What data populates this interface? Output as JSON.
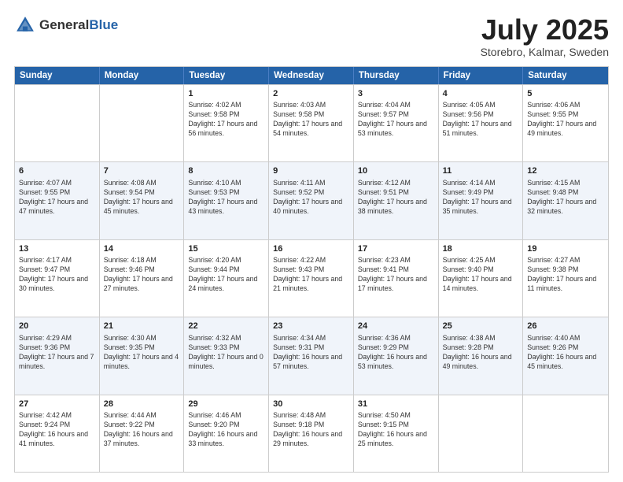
{
  "header": {
    "logo_general": "General",
    "logo_blue": "Blue",
    "month_title": "July 2025",
    "location": "Storebro, Kalmar, Sweden"
  },
  "weekdays": [
    "Sunday",
    "Monday",
    "Tuesday",
    "Wednesday",
    "Thursday",
    "Friday",
    "Saturday"
  ],
  "rows": [
    {
      "alt": false,
      "cells": [
        {
          "day": "",
          "info": ""
        },
        {
          "day": "",
          "info": ""
        },
        {
          "day": "1",
          "info": "Sunrise: 4:02 AM\nSunset: 9:58 PM\nDaylight: 17 hours and 56 minutes."
        },
        {
          "day": "2",
          "info": "Sunrise: 4:03 AM\nSunset: 9:58 PM\nDaylight: 17 hours and 54 minutes."
        },
        {
          "day": "3",
          "info": "Sunrise: 4:04 AM\nSunset: 9:57 PM\nDaylight: 17 hours and 53 minutes."
        },
        {
          "day": "4",
          "info": "Sunrise: 4:05 AM\nSunset: 9:56 PM\nDaylight: 17 hours and 51 minutes."
        },
        {
          "day": "5",
          "info": "Sunrise: 4:06 AM\nSunset: 9:55 PM\nDaylight: 17 hours and 49 minutes."
        }
      ]
    },
    {
      "alt": true,
      "cells": [
        {
          "day": "6",
          "info": "Sunrise: 4:07 AM\nSunset: 9:55 PM\nDaylight: 17 hours and 47 minutes."
        },
        {
          "day": "7",
          "info": "Sunrise: 4:08 AM\nSunset: 9:54 PM\nDaylight: 17 hours and 45 minutes."
        },
        {
          "day": "8",
          "info": "Sunrise: 4:10 AM\nSunset: 9:53 PM\nDaylight: 17 hours and 43 minutes."
        },
        {
          "day": "9",
          "info": "Sunrise: 4:11 AM\nSunset: 9:52 PM\nDaylight: 17 hours and 40 minutes."
        },
        {
          "day": "10",
          "info": "Sunrise: 4:12 AM\nSunset: 9:51 PM\nDaylight: 17 hours and 38 minutes."
        },
        {
          "day": "11",
          "info": "Sunrise: 4:14 AM\nSunset: 9:49 PM\nDaylight: 17 hours and 35 minutes."
        },
        {
          "day": "12",
          "info": "Sunrise: 4:15 AM\nSunset: 9:48 PM\nDaylight: 17 hours and 32 minutes."
        }
      ]
    },
    {
      "alt": false,
      "cells": [
        {
          "day": "13",
          "info": "Sunrise: 4:17 AM\nSunset: 9:47 PM\nDaylight: 17 hours and 30 minutes."
        },
        {
          "day": "14",
          "info": "Sunrise: 4:18 AM\nSunset: 9:46 PM\nDaylight: 17 hours and 27 minutes."
        },
        {
          "day": "15",
          "info": "Sunrise: 4:20 AM\nSunset: 9:44 PM\nDaylight: 17 hours and 24 minutes."
        },
        {
          "day": "16",
          "info": "Sunrise: 4:22 AM\nSunset: 9:43 PM\nDaylight: 17 hours and 21 minutes."
        },
        {
          "day": "17",
          "info": "Sunrise: 4:23 AM\nSunset: 9:41 PM\nDaylight: 17 hours and 17 minutes."
        },
        {
          "day": "18",
          "info": "Sunrise: 4:25 AM\nSunset: 9:40 PM\nDaylight: 17 hours and 14 minutes."
        },
        {
          "day": "19",
          "info": "Sunrise: 4:27 AM\nSunset: 9:38 PM\nDaylight: 17 hours and 11 minutes."
        }
      ]
    },
    {
      "alt": true,
      "cells": [
        {
          "day": "20",
          "info": "Sunrise: 4:29 AM\nSunset: 9:36 PM\nDaylight: 17 hours and 7 minutes."
        },
        {
          "day": "21",
          "info": "Sunrise: 4:30 AM\nSunset: 9:35 PM\nDaylight: 17 hours and 4 minutes."
        },
        {
          "day": "22",
          "info": "Sunrise: 4:32 AM\nSunset: 9:33 PM\nDaylight: 17 hours and 0 minutes."
        },
        {
          "day": "23",
          "info": "Sunrise: 4:34 AM\nSunset: 9:31 PM\nDaylight: 16 hours and 57 minutes."
        },
        {
          "day": "24",
          "info": "Sunrise: 4:36 AM\nSunset: 9:29 PM\nDaylight: 16 hours and 53 minutes."
        },
        {
          "day": "25",
          "info": "Sunrise: 4:38 AM\nSunset: 9:28 PM\nDaylight: 16 hours and 49 minutes."
        },
        {
          "day": "26",
          "info": "Sunrise: 4:40 AM\nSunset: 9:26 PM\nDaylight: 16 hours and 45 minutes."
        }
      ]
    },
    {
      "alt": false,
      "cells": [
        {
          "day": "27",
          "info": "Sunrise: 4:42 AM\nSunset: 9:24 PM\nDaylight: 16 hours and 41 minutes."
        },
        {
          "day": "28",
          "info": "Sunrise: 4:44 AM\nSunset: 9:22 PM\nDaylight: 16 hours and 37 minutes."
        },
        {
          "day": "29",
          "info": "Sunrise: 4:46 AM\nSunset: 9:20 PM\nDaylight: 16 hours and 33 minutes."
        },
        {
          "day": "30",
          "info": "Sunrise: 4:48 AM\nSunset: 9:18 PM\nDaylight: 16 hours and 29 minutes."
        },
        {
          "day": "31",
          "info": "Sunrise: 4:50 AM\nSunset: 9:15 PM\nDaylight: 16 hours and 25 minutes."
        },
        {
          "day": "",
          "info": ""
        },
        {
          "day": "",
          "info": ""
        }
      ]
    }
  ]
}
